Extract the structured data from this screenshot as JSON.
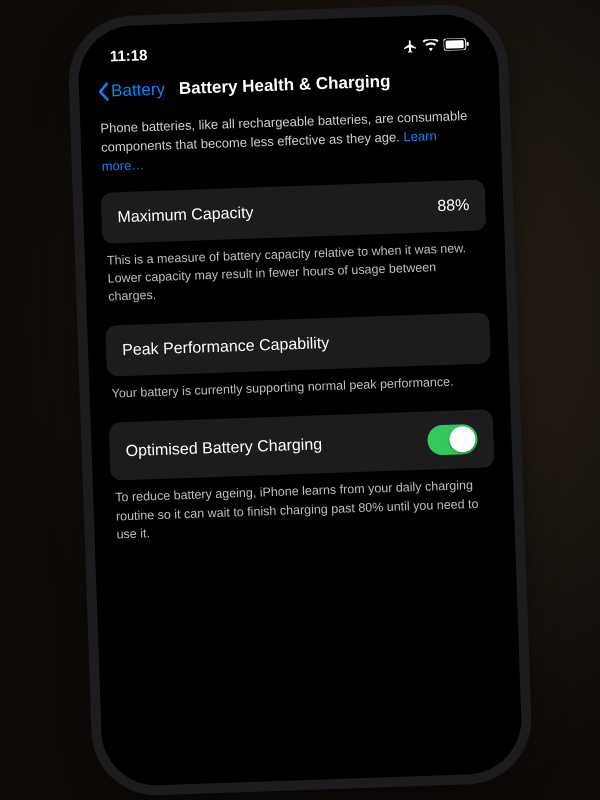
{
  "status": {
    "time": "11:18"
  },
  "nav": {
    "back_label": "Battery",
    "title": "Battery Health & Charging"
  },
  "intro": {
    "text": "Phone batteries, like all rechargeable batteries, are consumable components that become less effective as they age. ",
    "link": "Learn more…"
  },
  "capacity": {
    "label": "Maximum Capacity",
    "value": "88%",
    "footer": "This is a measure of battery capacity relative to when it was new. Lower capacity may result in fewer hours of usage between charges."
  },
  "peak": {
    "label": "Peak Performance Capability",
    "footer": "Your battery is currently supporting normal peak performance."
  },
  "optimised": {
    "label": "Optimised Battery Charging",
    "toggle_on": true,
    "footer": "To reduce battery ageing, iPhone learns from your daily charging routine so it can wait to finish charging past 80% until you need to use it."
  }
}
